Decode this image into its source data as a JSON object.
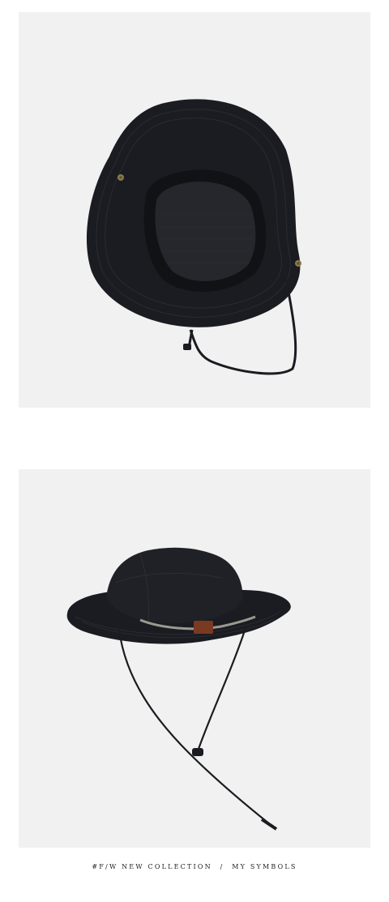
{
  "colors": {
    "background": "#ffffff",
    "panel": "#f1f1f1",
    "hat": "#1b1c21",
    "caption_text": "#222222"
  },
  "images": [
    {
      "subject": "black bucket hat, view from underside with chin strap"
    },
    {
      "subject": "black bucket hat, side view with cord and leather tag"
    }
  ],
  "caption": {
    "left": "#F/W NEW COLLECTION",
    "separator": "/",
    "right": "MY SYMBOLS"
  }
}
